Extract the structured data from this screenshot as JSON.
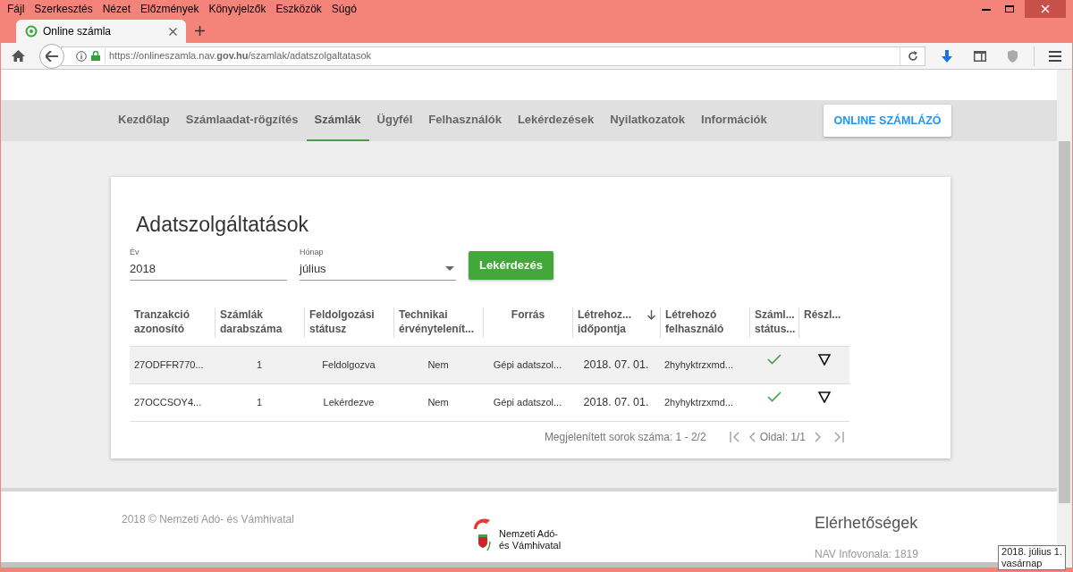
{
  "menu_bar": [
    "Fájl",
    "Szerkesztés",
    "Nézet",
    "Előzmények",
    "Könyvjelzők",
    "Eszközök",
    "Súgó"
  ],
  "browser_tab": {
    "title": "Online számla",
    "selected": true
  },
  "address_bar": {
    "url": "https://onlineszamla.nav.**gov.hu**/szamlak/adatszolgaltatasok"
  },
  "nav": {
    "items": [
      {
        "label": "Kezdőlap",
        "selected": false
      },
      {
        "label": "Számlaadat-rögzítés",
        "selected": false
      },
      {
        "label": "Számlák",
        "selected": true
      },
      {
        "label": "Ügyfél",
        "selected": false
      },
      {
        "label": "Felhasználók",
        "selected": false
      },
      {
        "label": "Lekérdezések",
        "selected": false
      },
      {
        "label": "Nyilatkozatok",
        "selected": false
      },
      {
        "label": "Információk",
        "selected": false
      }
    ],
    "cta": "ONLINE SZÁMLÁZÓ"
  },
  "card": {
    "title": "Adatszolgáltatások",
    "year_field": {
      "label": "Év",
      "value": "2018"
    },
    "month_field": {
      "label": "Hónap",
      "value": "július"
    },
    "query_button": "Lekérdezés",
    "table": {
      "columns": [
        {
          "label": "Tranzakció azonosító",
          "sorted": false
        },
        {
          "label": "Számlák darabszáma",
          "sorted": false
        },
        {
          "label": "Feldolgozási státusz",
          "sorted": false
        },
        {
          "label": "Technikai érvénytelenít...",
          "sorted": false
        },
        {
          "label": "Forrás",
          "sorted": false
        },
        {
          "label": "Létrehoz... időpontja",
          "sorted": true
        },
        {
          "label": "Létrehozó felhasználó",
          "sorted": false
        },
        {
          "label": "Száml... státus...",
          "sorted": false
        },
        {
          "label": "Részl...",
          "sorted": false
        }
      ],
      "rows": [
        {
          "highlighted": true,
          "cells": [
            "27ODFFR770...",
            "1",
            "Feldolgozva",
            "Nem",
            "Gépi adatszol...",
            "2018. 07. 01.",
            "2hyhyktrzxmd..."
          ]
        },
        {
          "highlighted": false,
          "cells": [
            "27OCCSOY4...",
            "1",
            "Lekérdezve",
            "Nem",
            "Gépi adatszol...",
            "2018. 07. 01.",
            "2hyhyktrzxmd..."
          ]
        }
      ]
    },
    "pagination": {
      "rows_info": "Megjelenített sorok száma: 1 - 2/2",
      "page_info": "Oldal: 1/1"
    }
  },
  "footer": {
    "copyright": "2018 © Nemzeti Adó- és Vámhivatal",
    "logo_line_1": "Nemzeti Adó-",
    "logo_line_2": "és Vámhivatal",
    "contacts_title": "Elérhetőségek",
    "hotline": "NAV Infovonala: 1819"
  },
  "clock_tooltip": {
    "line_1": "2018. július 1.",
    "line_2": "vasárnap"
  }
}
